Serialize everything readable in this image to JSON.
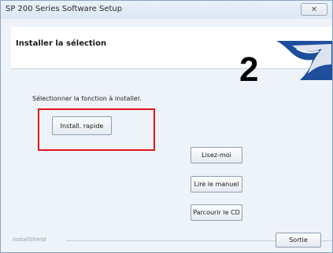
{
  "window": {
    "title": "SP 200 Series Software Setup",
    "close_glyph": "✕"
  },
  "header": {
    "title": "Installer la sélection",
    "step_number": "2",
    "logo_icon": "blue-wing-logo-icon"
  },
  "main": {
    "instruction": "Sélectionner la fonction à installer.",
    "buttons": {
      "quick_install": "Install. rapide",
      "readme": "Lisez-moi",
      "read_manual": "Lire le manuel",
      "browse_cd": "Parcourir le CD",
      "exit": "Sortie"
    },
    "footer_group_label": "InstallShield"
  },
  "colors": {
    "highlight": "#e0161d",
    "logo_blue": "#1f4e9c"
  }
}
